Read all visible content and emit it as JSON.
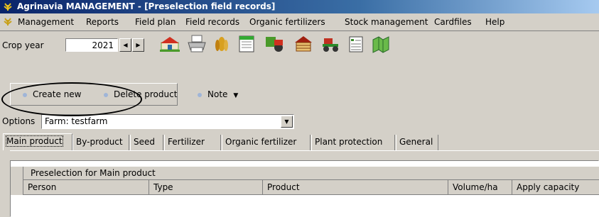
{
  "window": {
    "title": "Agrinavia MANAGEMENT - [Preselection field records]"
  },
  "menu": [
    "Management",
    "Reports",
    "Field plan",
    "Field records",
    "Organic fertilizers",
    "Stock management",
    "Cardfiles",
    "Help"
  ],
  "toolbar": {
    "crop_year_label": "Crop year",
    "crop_year_value": "2021",
    "icons": [
      "farm-icon",
      "printer-icon",
      "grain-icon",
      "calendar-icon",
      "field-machine-icon",
      "barn-icon",
      "tractor-icon",
      "list-icon",
      "map-icon"
    ]
  },
  "actions": {
    "create_new": "Create new",
    "delete_product": "Delete product",
    "note": "Note"
  },
  "options": {
    "label": "Options",
    "selected": "Farm: testfarm"
  },
  "tabs": [
    "Main product",
    "By-product",
    "Seed",
    "Fertilizer",
    "Organic fertilizer",
    "Plant protection",
    "General"
  ],
  "grid": {
    "group_header": "Preselection for Main product",
    "columns": [
      "Person",
      "Type",
      "Product",
      "Volume/ha",
      "Apply capacity"
    ]
  },
  "colors": {
    "titlebar": "#0a246a",
    "window_bg": "#d4d0c8",
    "annotation": "#000000"
  }
}
